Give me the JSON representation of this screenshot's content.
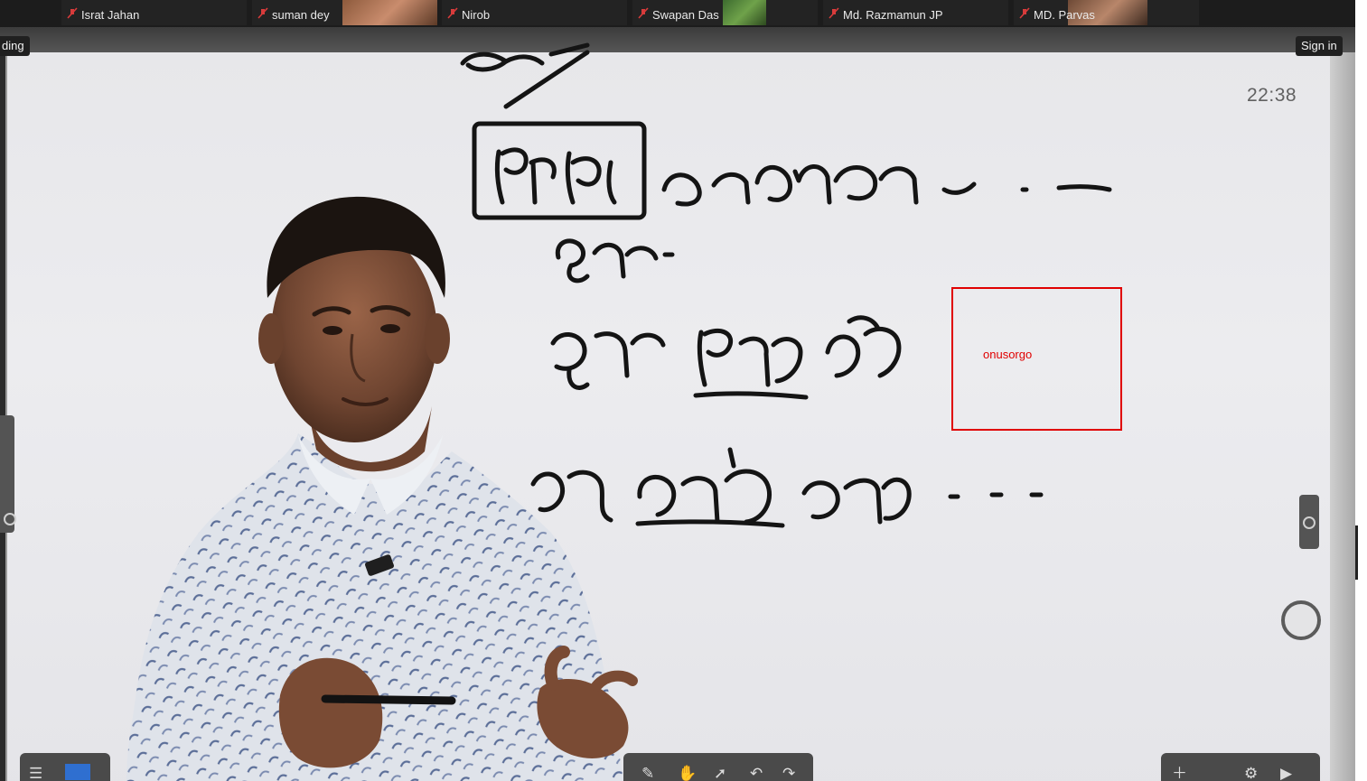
{
  "participants": [
    {
      "name": "Israt Jahan",
      "muted": true
    },
    {
      "name": "suman dey",
      "muted": true
    },
    {
      "name": "Nirob",
      "muted": true
    },
    {
      "name": "Swapan Das",
      "muted": true
    },
    {
      "name": "Md. Razmamun JP",
      "muted": true
    },
    {
      "name": "MD. Parvas",
      "muted": true
    }
  ],
  "header": {
    "recording_label": "ding",
    "sign_in": "Sign in"
  },
  "board": {
    "clock": "22:38"
  },
  "annotation": {
    "text": "onusorgo",
    "color": "#e00000"
  },
  "icons": {
    "muted": "muted-mic-icon",
    "record": "record-ring-icon"
  }
}
